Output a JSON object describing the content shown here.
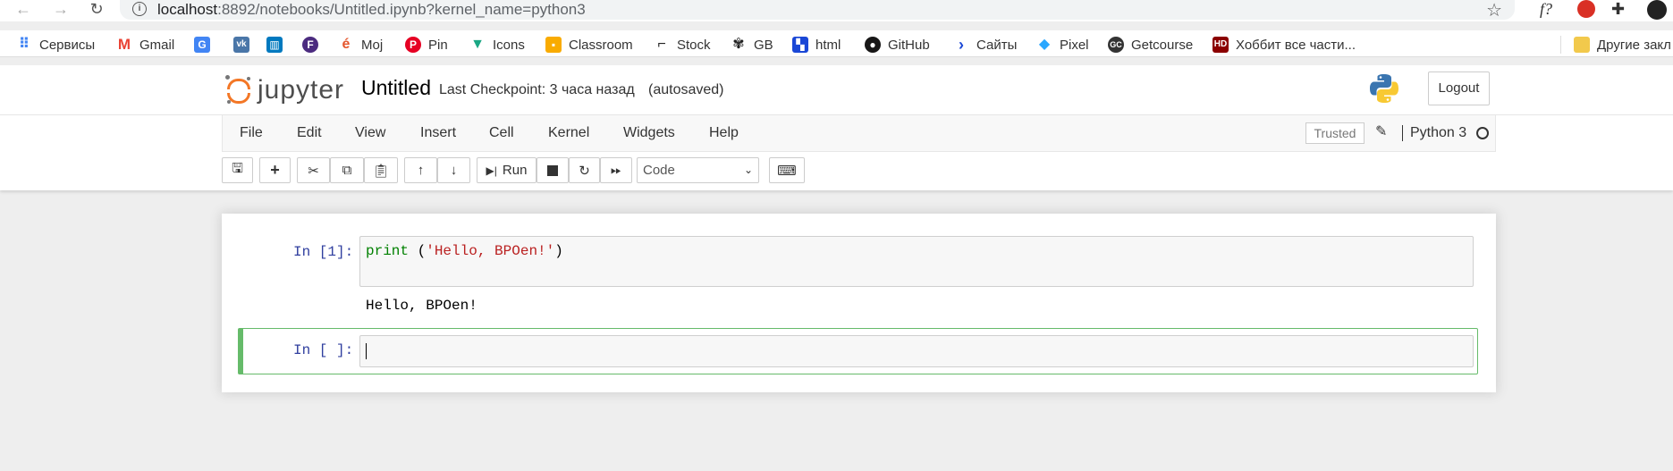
{
  "browser": {
    "url_host": "localhost",
    "url_rest": ":8892/notebooks/Untitled.ipynb?kernel_name=python3",
    "bookmarks": [
      {
        "label": "Сервисы",
        "icon": "apps-grid-icon",
        "color": "#4285f4"
      },
      {
        "label": "Gmail",
        "icon": "gmail-icon",
        "color": "#ea4335"
      },
      {
        "label": "",
        "icon": "google-translate-icon",
        "color": "#4285f4"
      },
      {
        "label": "",
        "icon": "vk-icon",
        "color": "#4a76a8"
      },
      {
        "label": "",
        "icon": "trello-icon",
        "color": "#0079bf"
      },
      {
        "label": "",
        "icon": "f-icon",
        "color": "#4b2b7f"
      },
      {
        "label": "Moj",
        "icon": "moj-icon",
        "color": "#e4572e"
      },
      {
        "label": "Pin",
        "icon": "pinterest-icon",
        "color": "#e60023"
      },
      {
        "label": "Icons",
        "icon": "icons-icon",
        "color": "#1ba784"
      },
      {
        "label": "Classroom",
        "icon": "classroom-icon",
        "color": "#f9ab00"
      },
      {
        "label": "Stock",
        "icon": "stock-icon",
        "color": "#222222"
      },
      {
        "label": "GB",
        "icon": "openai-icon",
        "color": "#222222"
      },
      {
        "label": "html",
        "icon": "html-icon",
        "color": "#1a47d6"
      },
      {
        "label": "GitHub",
        "icon": "github-icon",
        "color": "#181717"
      },
      {
        "label": "Сайты",
        "icon": "chevron-icon",
        "color": "#1a47d6"
      },
      {
        "label": "Pixel",
        "icon": "pixel-icon",
        "color": "#2aa7ff"
      },
      {
        "label": "Getcourse",
        "icon": "getcourse-icon",
        "color": "#222222"
      },
      {
        "label": "Хоббит все части...",
        "icon": "hd-icon",
        "color": "#8b0000"
      },
      {
        "label": "Другие закл",
        "icon": "folder-icon",
        "color": "#f2c94c"
      }
    ]
  },
  "header": {
    "logo_text": "jupyter",
    "notebook_name": "Untitled",
    "checkpoint": "Last Checkpoint: 3 часа назад",
    "autosaved": "(autosaved)",
    "logout": "Logout"
  },
  "menubar": {
    "items": [
      "File",
      "Edit",
      "View",
      "Insert",
      "Cell",
      "Kernel",
      "Widgets",
      "Help"
    ],
    "trusted": "Trusted",
    "kernel": "Python 3"
  },
  "toolbar": {
    "run_label": "Run",
    "cell_type": "Code"
  },
  "cells": [
    {
      "prompt": "In [1]:",
      "code_kw": "print",
      "code_open": " (",
      "code_str": "'Hello, BPOen!'",
      "code_close": ")",
      "output": "Hello, BPOen!"
    },
    {
      "prompt": "In [ ]:"
    }
  ]
}
